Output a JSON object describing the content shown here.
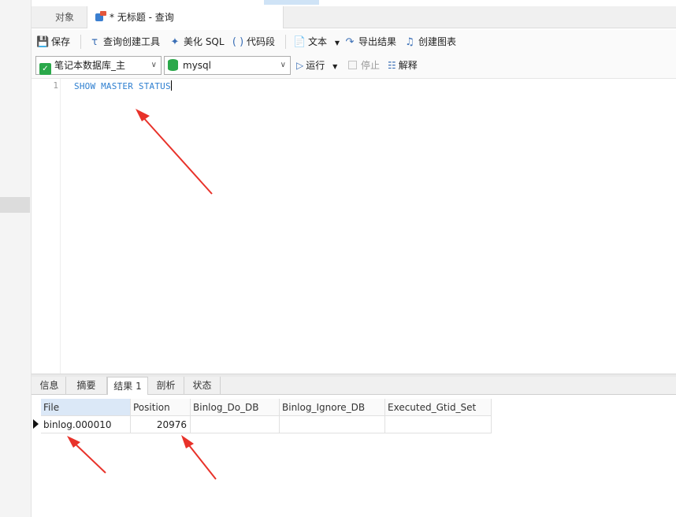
{
  "tabs": {
    "objects_label": "对象",
    "query_label": "* 无标题 - 查询"
  },
  "toolbar": {
    "save_label": "保存",
    "query_builder_label": "查询创建工具",
    "beautify_label": "美化 SQL",
    "code_snippet_label": "代码段",
    "text_label": "文本",
    "export_label": "导出结果",
    "create_chart_label": "创建图表"
  },
  "connection": {
    "connection_value": "笔记本数据库_主",
    "database_value": "mysql",
    "run_label": "运行",
    "stop_label": "停止",
    "explain_label": "解释"
  },
  "editor": {
    "line_number": "1",
    "code": "SHOW MASTER STATUS"
  },
  "result_tabs": [
    "信息",
    "摘要",
    "结果 1",
    "剖析",
    "状态"
  ],
  "grid": {
    "columns": [
      "File",
      "Position",
      "Binlog_Do_DB",
      "Binlog_Ignore_DB",
      "Executed_Gtid_Set"
    ],
    "rows": [
      [
        "binlog.000010",
        "20976",
        "",
        "",
        ""
      ]
    ]
  },
  "colors": {
    "keyword_blue": "#2e7fd0",
    "annotation_red": "#e8322a",
    "selected_header": "#dbe8f7"
  }
}
